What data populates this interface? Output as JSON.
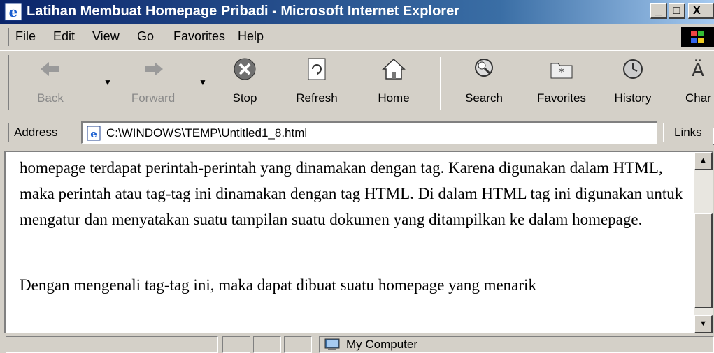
{
  "window": {
    "title": "Latihan Membuat Homepage Pribadi - Microsoft Internet Explorer",
    "controls": {
      "minimize": "_",
      "maximize": "□",
      "close": "X"
    }
  },
  "menu": [
    {
      "label": "File"
    },
    {
      "label": "Edit"
    },
    {
      "label": "View"
    },
    {
      "label": "Go"
    },
    {
      "label": "Favorites"
    },
    {
      "label": "Help"
    }
  ],
  "toolbar": [
    {
      "label": "Back",
      "icon": "back-arrow-icon",
      "enabled": false
    },
    {
      "label": "Forward",
      "icon": "forward-arrow-icon",
      "enabled": false
    },
    {
      "label": "Stop",
      "icon": "stop-icon",
      "enabled": true
    },
    {
      "label": "Refresh",
      "icon": "refresh-icon",
      "enabled": true
    },
    {
      "label": "Home",
      "icon": "home-icon",
      "enabled": true
    },
    {
      "label": "Search",
      "icon": "search-icon",
      "enabled": true
    },
    {
      "label": "Favorites",
      "icon": "favorites-icon",
      "enabled": true
    },
    {
      "label": "History",
      "icon": "history-icon",
      "enabled": true
    },
    {
      "label": "Char",
      "icon": "character-icon",
      "enabled": true
    }
  ],
  "address": {
    "label": "Address",
    "url": "C:\\WINDOWS\\TEMP\\Untitled1_8.html",
    "links_label": "Links"
  },
  "content": {
    "paragraph1": "homepage terdapat perintah-perintah yang dinamakan dengan tag. Karena digunakan dalam HTML, maka perintah atau tag-tag ini dinamakan dengan tag HTML. Di dalam HTML tag ini digunakan untuk mengatur dan menyatakan suatu tampilan suatu dokumen yang ditampilkan ke dalam homepage.",
    "paragraph2": "Dengan mengenali tag-tag ini, maka dapat dibuat suatu homepage yang menarik"
  },
  "status": {
    "zone": "My Computer"
  },
  "colors": {
    "titlebar_start": "#0a246a",
    "titlebar_end": "#a6caf0",
    "chrome": "#d4d0c8"
  }
}
